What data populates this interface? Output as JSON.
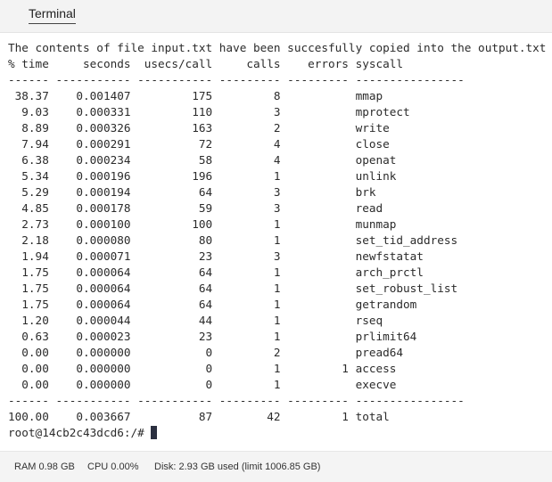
{
  "tab": {
    "label": "Terminal"
  },
  "terminal": {
    "lines": [
      "The contents of file input.txt have been succesfully copied into the output.txt file.",
      "% time     seconds  usecs/call     calls    errors syscall",
      "------ ----------- ----------- --------- --------- ----------------",
      " 38.37    0.001407         175         8           mmap",
      "  9.03    0.000331         110         3           mprotect",
      "  8.89    0.000326         163         2           write",
      "  7.94    0.000291          72         4           close",
      "  6.38    0.000234          58         4           openat",
      "  5.34    0.000196         196         1           unlink",
      "  5.29    0.000194          64         3           brk",
      "  4.85    0.000178          59         3           read",
      "  2.73    0.000100         100         1           munmap",
      "  2.18    0.000080          80         1           set_tid_address",
      "  1.94    0.000071          23         3           newfstatat",
      "  1.75    0.000064          64         1           arch_prctl",
      "  1.75    0.000064          64         1           set_robust_list",
      "  1.75    0.000064          64         1           getrandom",
      "  1.20    0.000044          44         1           rseq",
      "  0.63    0.000023          23         1           prlimit64",
      "  0.00    0.000000           0         2           pread64",
      "  0.00    0.000000           0         1         1 access",
      "  0.00    0.000000           0         1           execve",
      "------ ----------- ----------- --------- --------- ----------------",
      "100.00    0.003667          87        42         1 total"
    ],
    "prompt": "root@14cb2c43dcd6:/# "
  },
  "status": {
    "ram": "RAM 0.98 GB",
    "cpu": "CPU 0.00%",
    "disk": "Disk: 2.93 GB used (limit 1006.85 GB)"
  }
}
